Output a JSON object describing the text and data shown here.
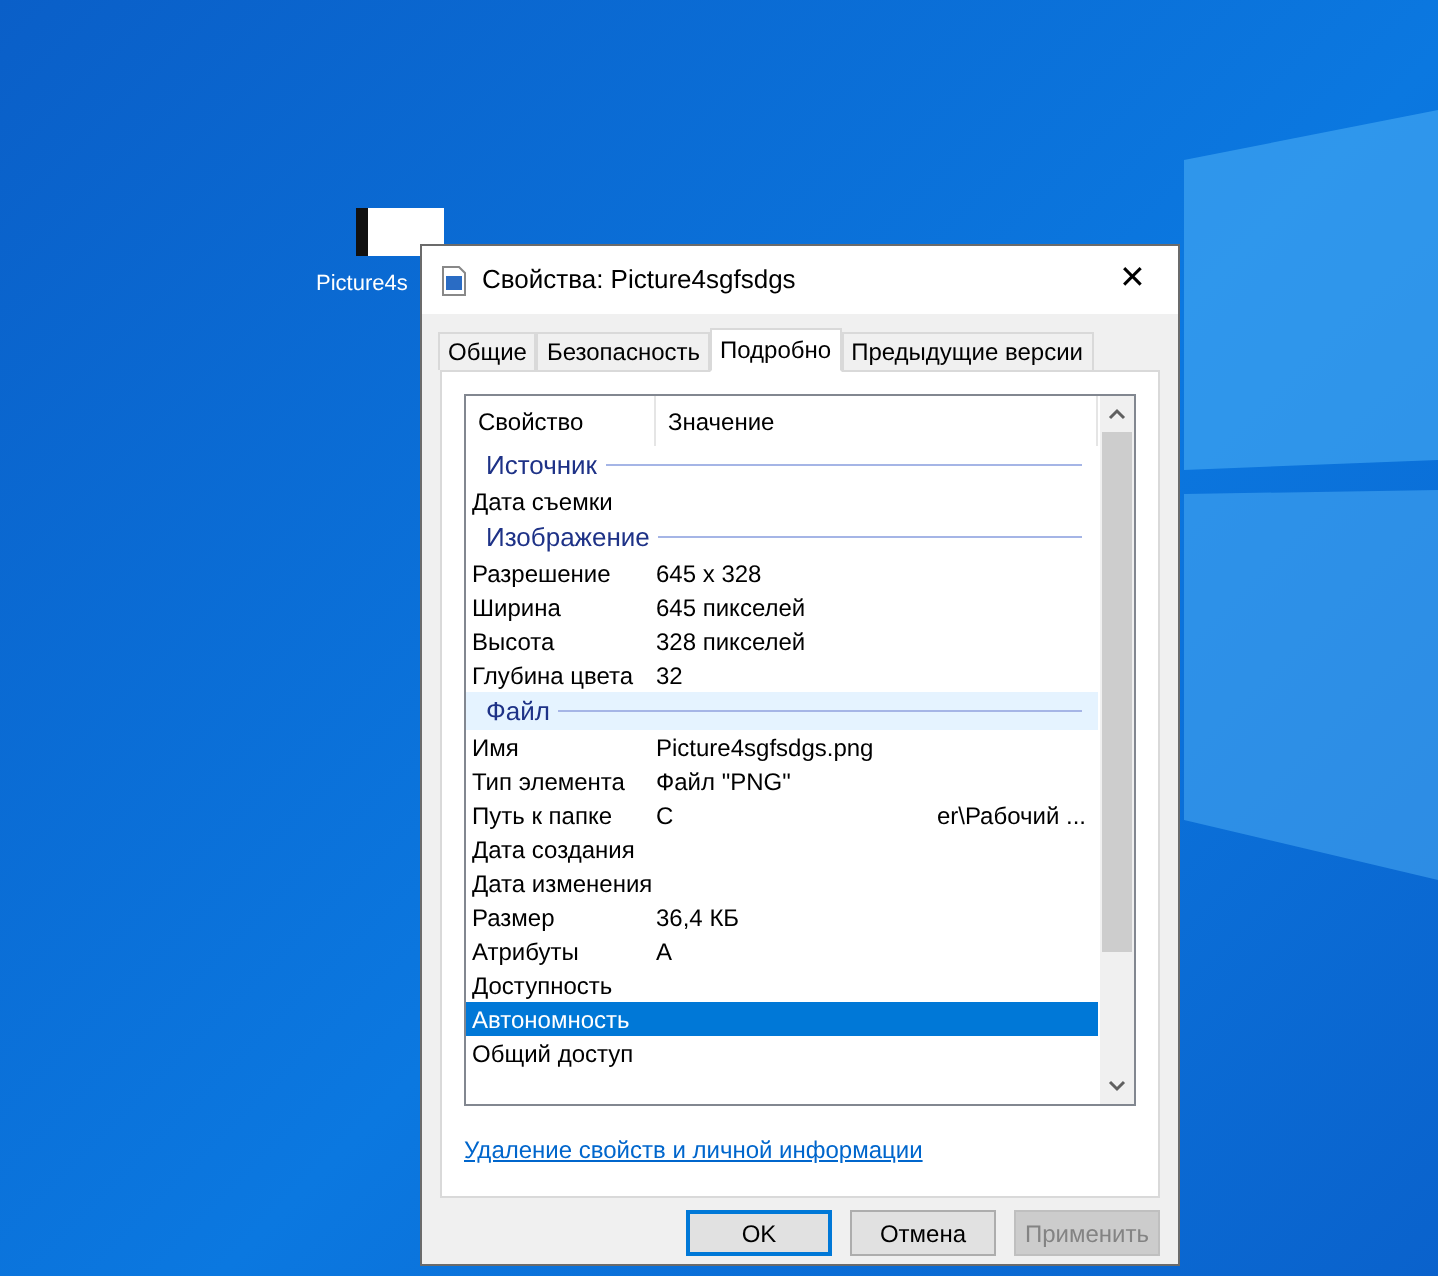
{
  "desktop_icon": {
    "label": "Picture4s"
  },
  "window": {
    "title": "Свойства: Picture4sgfsdgs",
    "close": "✕"
  },
  "tabs": [
    {
      "label": "Общие",
      "selected": false
    },
    {
      "label": "Безопасность",
      "selected": false
    },
    {
      "label": "Подробно",
      "selected": true
    },
    {
      "label": "Предыдущие версии",
      "selected": false
    }
  ],
  "table": {
    "columns": [
      "Свойство",
      "Значение"
    ],
    "groups": [
      {
        "title": "Источник",
        "hovered": false,
        "rows": [
          {
            "property": "Дата съемки",
            "selected": false
          }
        ]
      },
      {
        "title": "Изображение",
        "hovered": false,
        "rows": [
          {
            "property": "Разрешение",
            "value": "645 x 328",
            "selected": false
          },
          {
            "property": "Ширина",
            "value": "645 пикселей",
            "selected": false
          },
          {
            "property": "Высота",
            "value": "328 пикселей",
            "selected": false
          },
          {
            "property": "Глубина цвета",
            "value": "32",
            "selected": false
          }
        ]
      },
      {
        "title": "Файл",
        "hovered": true,
        "rows": [
          {
            "property": "Имя",
            "value": "Picture4sgfsdgs.png",
            "selected": false
          },
          {
            "property": "Тип элемента",
            "value": "Файл \"PNG\"",
            "selected": false
          },
          {
            "property": "Путь к папке",
            "value": "C",
            "value_end": "er\\Рабочий ...",
            "selected": false
          },
          {
            "property": "Дата создания",
            "selected": false
          },
          {
            "property": "Дата изменения",
            "selected": false
          },
          {
            "property": "Размер",
            "value": "36,4 КБ",
            "selected": false
          },
          {
            "property": "Атрибуты",
            "value": "A",
            "selected": false
          },
          {
            "property": "Доступность",
            "selected": false
          },
          {
            "property": "Автономность",
            "selected": true
          },
          {
            "property": "Общий доступ",
            "selected": false
          }
        ]
      }
    ]
  },
  "link": "Удаление свойств и личной информации",
  "buttons": [
    {
      "label": "OK",
      "kind": "default"
    },
    {
      "label": "Отмена",
      "kind": "normal"
    },
    {
      "label": "Применить",
      "kind": "disabled"
    }
  ]
}
